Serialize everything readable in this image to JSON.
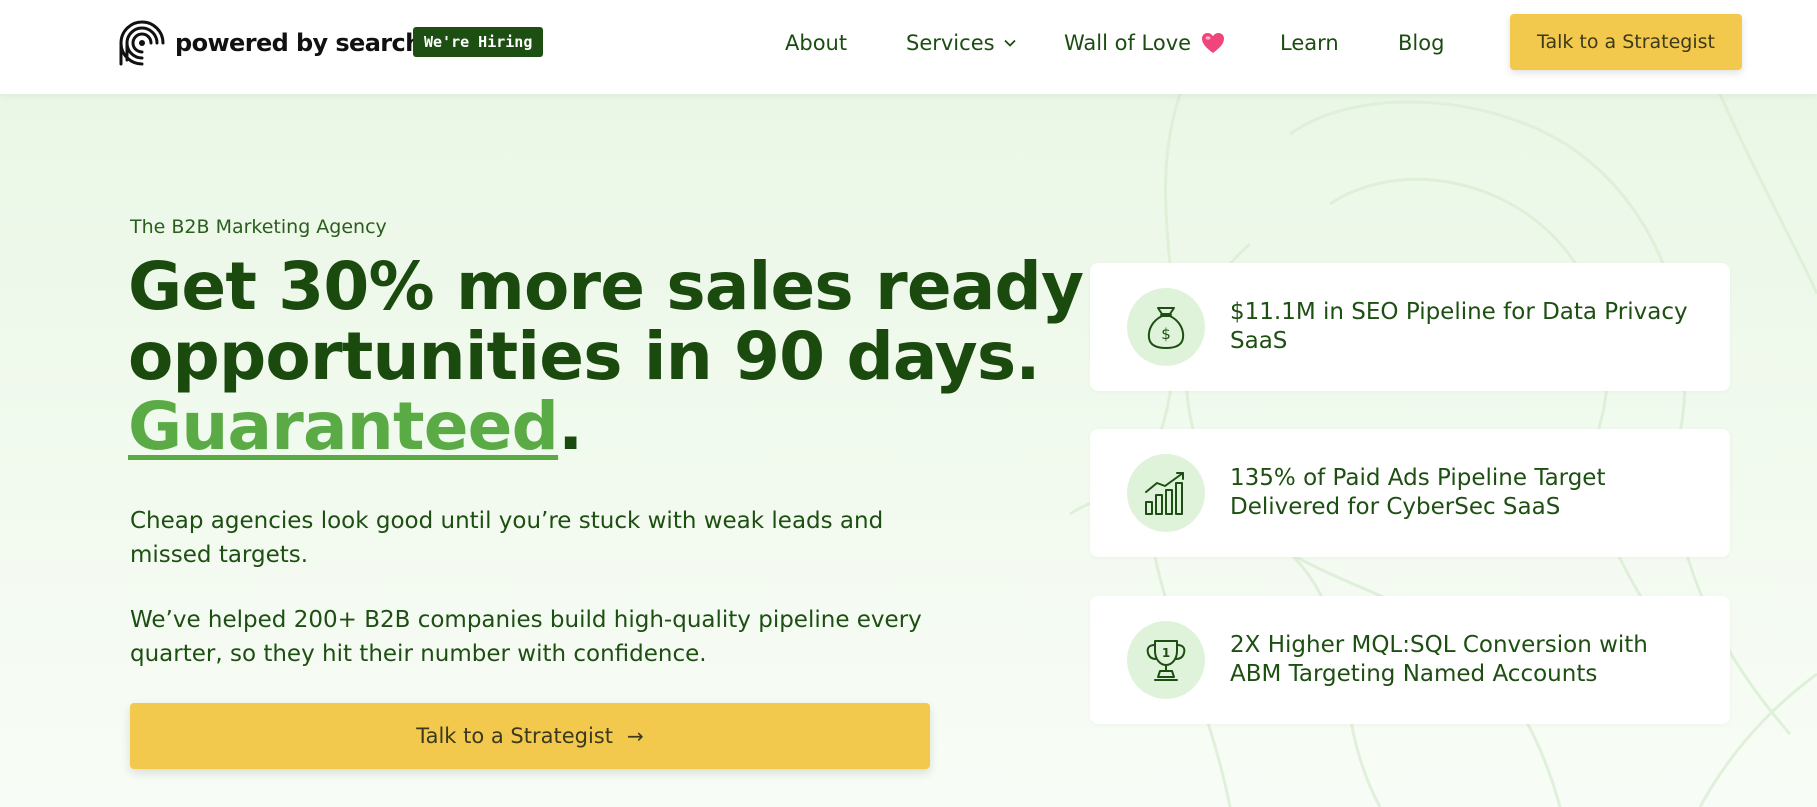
{
  "header": {
    "logo_text": "powered by search",
    "hiring_badge": "We're Hiring",
    "nav": {
      "about": "About",
      "services": "Services",
      "wall_of_love": "Wall of Love",
      "learn": "Learn",
      "blog": "Blog"
    },
    "cta": "Talk to a Strategist"
  },
  "hero": {
    "eyebrow": "The B2B Marketing Agency",
    "headline_line1": "Get 30% more sales ready",
    "headline_line2": "opportunities in 90 days.",
    "headline_accent": "Guaranteed",
    "headline_period": ".",
    "paragraph1": "Cheap agencies look good until you’re stuck with weak leads and missed targets.",
    "paragraph2": "We’ve helped 200+ B2B companies build high-quality pipeline every quarter, so they hit their number with confidence.",
    "cta": "Talk to a Strategist",
    "cta_arrow": "→"
  },
  "stats": [
    {
      "icon": "money-bag-icon",
      "text": "$11.1M in SEO Pipeline for Data Privacy SaaS"
    },
    {
      "icon": "growth-chart-icon",
      "text": "135% of Paid Ads Pipeline Target Delivered for CyberSec SaaS"
    },
    {
      "icon": "trophy-icon",
      "text": "2X Higher MQL:SQL Conversion with ABM Targeting Named Accounts"
    }
  ],
  "colors": {
    "dark_green": "#1a4a0e",
    "accent_green": "#5aaa45",
    "cta_yellow": "#f2c94c",
    "hero_bg": "#eaf7e6",
    "heart": "#f0457a"
  }
}
